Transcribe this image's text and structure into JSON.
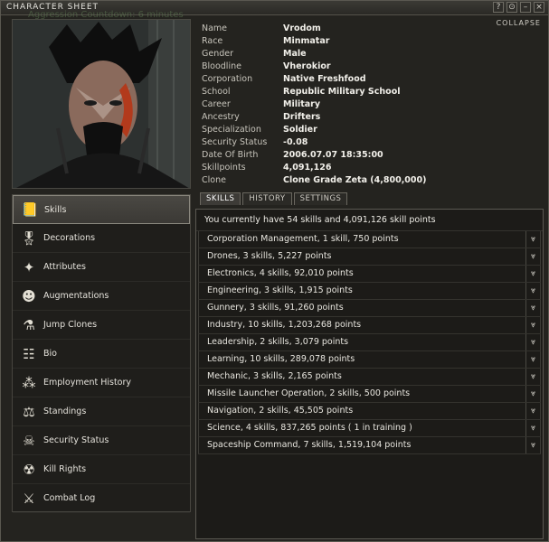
{
  "window": {
    "title": "CHARACTER SHEET",
    "ghost_text": "Aggression Countdown: 6 minutes",
    "buttons": [
      "?",
      "⊙",
      "–",
      "×"
    ],
    "collapse_label": "COLLAPSE"
  },
  "character": [
    {
      "label": "Name",
      "value": "Vrodom"
    },
    {
      "label": "Race",
      "value": "Minmatar"
    },
    {
      "label": "Gender",
      "value": "Male"
    },
    {
      "label": "Bloodline",
      "value": "Vherokior"
    },
    {
      "label": "Corporation",
      "value": "Native Freshfood"
    },
    {
      "label": "School",
      "value": "Republic Military School"
    },
    {
      "label": "Career",
      "value": "Military"
    },
    {
      "label": "Ancestry",
      "value": "Drifters"
    },
    {
      "label": "Specialization",
      "value": "Soldier"
    },
    {
      "label": "Security Status",
      "value": "-0.08"
    },
    {
      "label": "Date Of Birth",
      "value": "2006.07.07 18:35:00"
    },
    {
      "label": "Skillpoints",
      "value": "4,091,126"
    },
    {
      "label": "Clone",
      "value": "Clone Grade Zeta (4,800,000)"
    }
  ],
  "nav": [
    {
      "label": "Skills",
      "icon": "skills-book-icon",
      "glyph": "📒"
    },
    {
      "label": "Decorations",
      "icon": "medal-icon",
      "glyph": "🎖"
    },
    {
      "label": "Attributes",
      "icon": "attributes-icon",
      "glyph": "✦"
    },
    {
      "label": "Augmentations",
      "icon": "implant-head-icon",
      "glyph": "☻"
    },
    {
      "label": "Jump Clones",
      "icon": "clone-icon",
      "glyph": "⚗"
    },
    {
      "label": "Bio",
      "icon": "bio-card-icon",
      "glyph": "☷"
    },
    {
      "label": "Employment History",
      "icon": "employment-icon",
      "glyph": "⁂"
    },
    {
      "label": "Standings",
      "icon": "standings-icon",
      "glyph": "⚖"
    },
    {
      "label": "Security Status",
      "icon": "skull-icon",
      "glyph": "☠"
    },
    {
      "label": "Kill Rights",
      "icon": "kill-rights-icon",
      "glyph": "☢"
    },
    {
      "label": "Combat Log",
      "icon": "combat-log-icon",
      "glyph": "⚔"
    }
  ],
  "tabs": [
    "SKILLS",
    "HISTORY",
    "SETTINGS"
  ],
  "skills": {
    "summary": "You currently have 54 skills and 4,091,126 skill points",
    "groups": [
      "Corporation Management, 1  skill, 750  points",
      "Drones, 3  skills, 5,227  points",
      "Electronics, 4  skills, 92,010  points",
      "Engineering, 3  skills, 1,915  points",
      "Gunnery, 3  skills, 91,260  points",
      "Industry, 10  skills, 1,203,268  points",
      "Leadership, 2  skills, 3,079  points",
      "Learning, 10  skills, 289,078  points",
      "Mechanic, 3  skills, 2,165  points",
      "Missile Launcher Operation, 2  skills, 500  points",
      "Navigation, 2  skills, 45,505  points",
      "Science, 4  skills, 837,265  points ( 1  in training )",
      "Spaceship Command, 7  skills, 1,519,104  points"
    ]
  },
  "colors": {
    "background": "#24231f",
    "text": "#d8d6cf",
    "active_nav": "#4a4843"
  }
}
